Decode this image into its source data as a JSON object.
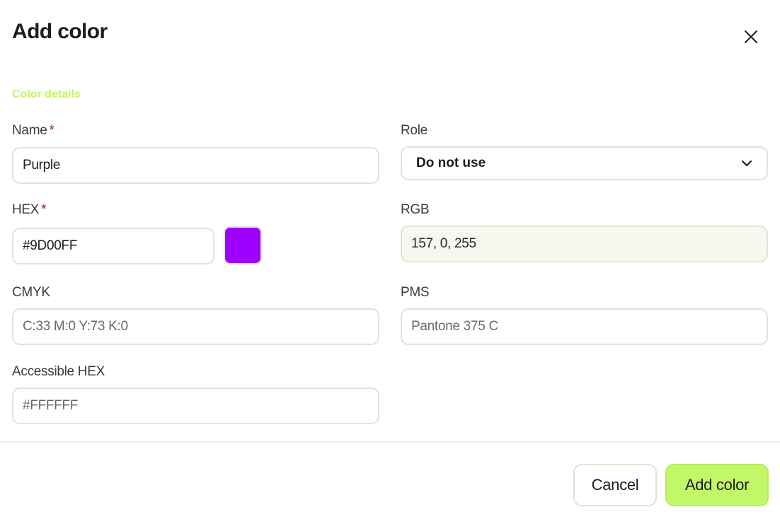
{
  "dialog": {
    "title": "Add color",
    "section_label": "Color details"
  },
  "fields": {
    "name": {
      "label": "Name",
      "required_mark": "*",
      "value": "Purple"
    },
    "role": {
      "label": "Role",
      "selected": "Do not use"
    },
    "hex": {
      "label": "HEX",
      "required_mark": "*",
      "value": "#9D00FF"
    },
    "rgb": {
      "label": "RGB",
      "value": "157, 0, 255"
    },
    "cmyk": {
      "label": "CMYK",
      "placeholder": "C:33 M:0 Y:73 K:0"
    },
    "pms": {
      "label": "PMS",
      "placeholder": "Pantone 375 C"
    },
    "accessible_hex": {
      "label": "Accessible HEX",
      "placeholder": "#FFFFFF"
    }
  },
  "swatch": {
    "color": "#9D00FF",
    "icon": "color-swatch"
  },
  "footer": {
    "cancel_label": "Cancel",
    "submit_label": "Add color"
  },
  "colors": {
    "accent": "#C3F26A",
    "primary_button": "#C2F768",
    "required": "#8A1531",
    "border": "#E1E4D3"
  }
}
